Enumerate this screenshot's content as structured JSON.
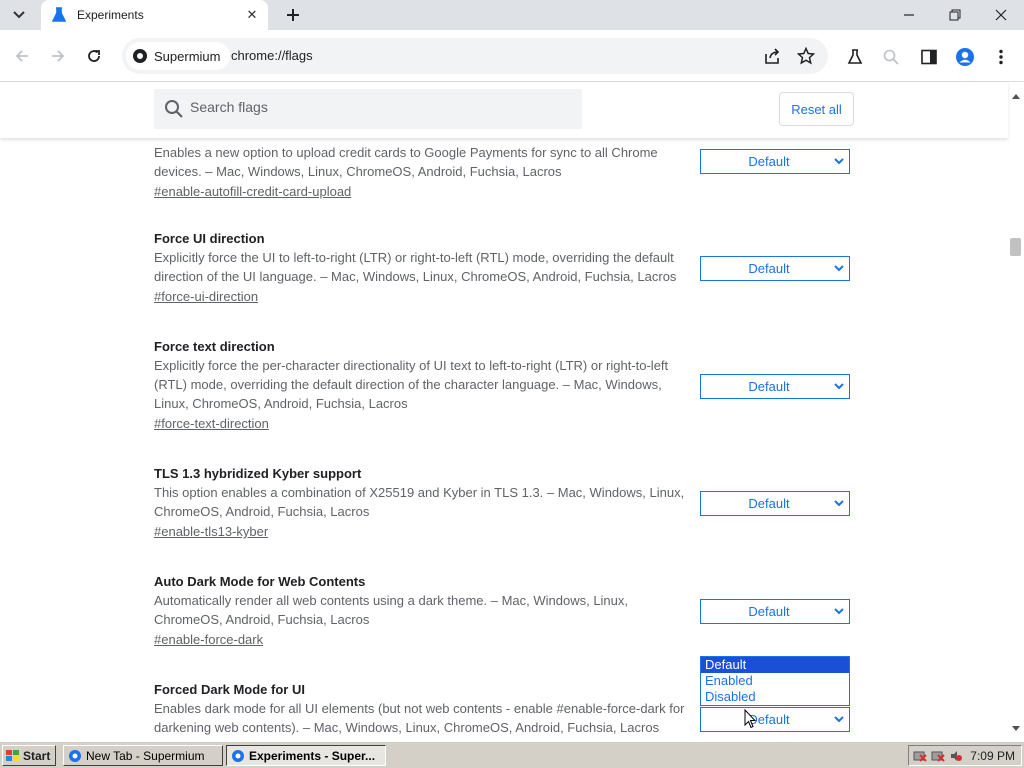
{
  "browser": {
    "tab_title": "Experiments",
    "site_chip": "Supermium",
    "url": "chrome://flags"
  },
  "flags_page": {
    "search_placeholder": "Search flags",
    "reset_all": "Reset all",
    "flags": [
      {
        "name": "",
        "description": "Enables a new option to upload credit cards to Google Payments for sync to all Chrome devices. – Mac, Windows, Linux, ChromeOS, Android, Fuchsia, Lacros",
        "link": "#enable-autofill-credit-card-upload",
        "value": "Default"
      },
      {
        "name": "Force UI direction",
        "description": "Explicitly force the UI to left-to-right (LTR) or right-to-left (RTL) mode, overriding the default direction of the UI language. – Mac, Windows, Linux, ChromeOS, Android, Fuchsia, Lacros",
        "link": "#force-ui-direction",
        "value": "Default"
      },
      {
        "name": "Force text direction",
        "description": "Explicitly force the per-character directionality of UI text to left-to-right (LTR) or right-to-left (RTL) mode, overriding the default direction of the character language. – Mac, Windows, Linux, ChromeOS, Android, Fuchsia, Lacros",
        "link": "#force-text-direction",
        "value": "Default"
      },
      {
        "name": "TLS 1.3 hybridized Kyber support",
        "description": "This option enables a combination of X25519 and Kyber in TLS 1.3. – Mac, Windows, Linux, ChromeOS, Android, Fuchsia, Lacros",
        "link": "#enable-tls13-kyber",
        "value": "Default"
      },
      {
        "name": "Auto Dark Mode for Web Contents",
        "description": "Automatically render all web contents using a dark theme. – Mac, Windows, Linux, ChromeOS, Android, Fuchsia, Lacros",
        "link": "#enable-force-dark",
        "value": "Default"
      },
      {
        "name": "Forced Dark Mode for UI",
        "description": "Enables dark mode for all UI elements (but not web contents - enable #enable-force-dark for darkening web contents). – Mac, Windows, Linux, ChromeOS, Android, Fuchsia, Lacros",
        "link": "",
        "value": "Default"
      }
    ],
    "dropdown_options": [
      "Default",
      "Enabled",
      "Disabled"
    ],
    "dropdown_selected": "Default"
  },
  "taskbar": {
    "start": "Start",
    "tasks": [
      "New Tab - Supermium",
      "Experiments - Super..."
    ],
    "clock": "7:09 PM"
  },
  "colors": {
    "accent": "#1a73e8",
    "selected_option": "#1a4fd6"
  }
}
